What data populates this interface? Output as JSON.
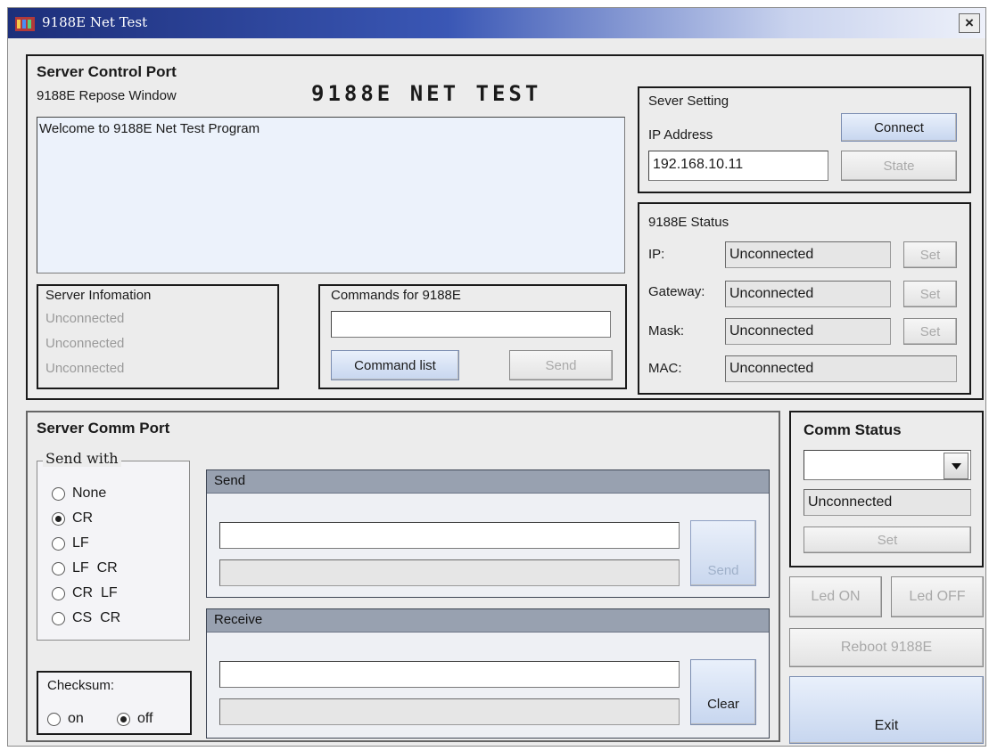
{
  "window": {
    "title": "9188E Net Test",
    "close_label": "×"
  },
  "control": {
    "title": "Server Control Port",
    "banner": "9188E NET TEST",
    "repose_label": "9188E Repose Window",
    "repose_text": "Welcome to 9188E Net Test Program"
  },
  "server_info": {
    "title": "Server Infomation",
    "lines": [
      "Unconnected",
      "Unconnected",
      "Unconnected"
    ]
  },
  "commands": {
    "title": "Commands for 9188E",
    "input_value": "",
    "list_button": "Command list",
    "send_button": "Send"
  },
  "sever_setting": {
    "title": "Sever Setting",
    "ip_label": "IP Address",
    "ip_value": "192.168.10.11",
    "connect_button": "Connect",
    "state_button": "State"
  },
  "status": {
    "title": "9188E Status",
    "rows": [
      {
        "label": "IP:",
        "value": "Unconnected",
        "button": "Set"
      },
      {
        "label": "Gateway:",
        "value": "Unconnected",
        "button": "Set"
      },
      {
        "label": "Mask:",
        "value": "Unconnected",
        "button": "Set"
      },
      {
        "label": "MAC:",
        "value": "Unconnected"
      }
    ]
  },
  "comm": {
    "title": "Server Comm Port",
    "send_with_title": "Send with",
    "options": [
      "None",
      "CR",
      "LF",
      "LF  CR",
      "CR  LF",
      "CS  CR"
    ],
    "selected_option": "CR",
    "checksum_label": "Checksum:",
    "checksum_on": "on",
    "checksum_off": "off",
    "checksum_selected": "off",
    "send_panel": {
      "title": "Send",
      "input_value": "",
      "button": "Send"
    },
    "receive_panel": {
      "title": "Receive",
      "button": "Clear"
    }
  },
  "comm_status": {
    "title": "Comm Status",
    "select_value": "",
    "status_value": "Unconnected",
    "set_button": "Set"
  },
  "actions": {
    "led_on": "Led ON",
    "led_off": "Led OFF",
    "reboot": "Reboot 9188E",
    "exit": "Exit"
  },
  "colors": {
    "title_gradient_start": "#1d2f7a",
    "button_blue": "#c7d6ef",
    "dark_panel": "#9099a8"
  }
}
